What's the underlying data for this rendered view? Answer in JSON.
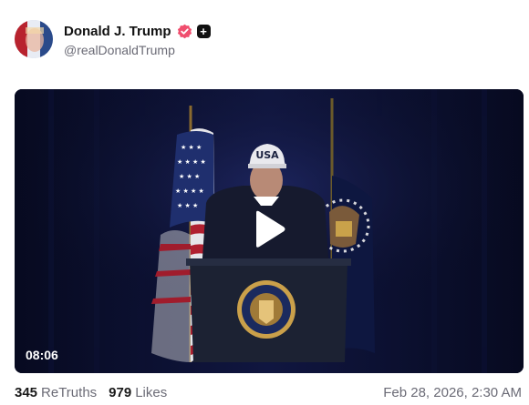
{
  "author": {
    "display_name": "Donald J. Trump",
    "handle": "@realDonaldTrump",
    "avatar_icon": "avatar-flag-portrait",
    "verified_icon": "verified-badge-icon",
    "verified_color": "#f04e6e",
    "plus_icon": "plus-badge-icon",
    "plus_symbol": "+"
  },
  "media": {
    "type": "video",
    "duration": "08:06",
    "play_icon": "play-icon",
    "cap_text": "USA"
  },
  "stats": {
    "retruths_count": "345",
    "retruths_label": "ReTruths",
    "likes_count": "979",
    "likes_label": "Likes"
  },
  "timestamp": "Feb 28, 2026, 2:30 AM"
}
